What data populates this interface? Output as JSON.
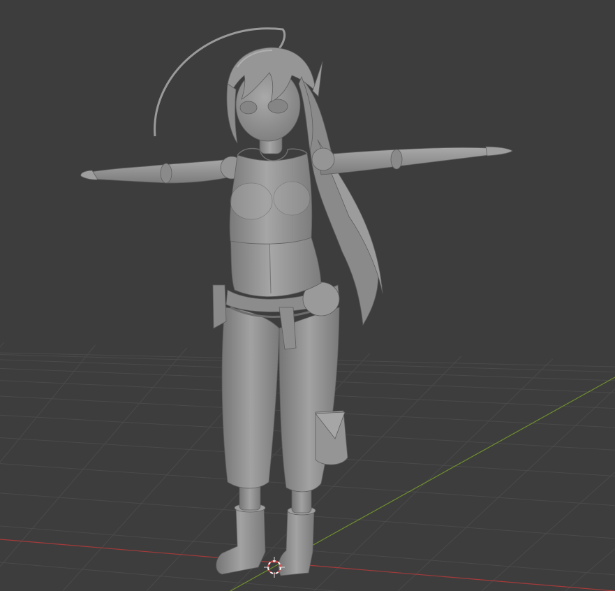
{
  "viewport": {
    "kind": "3d-viewport",
    "model": "character-t-pose-solid-shading",
    "colors": {
      "background": "#3d3d3d",
      "grid_line": "#4a4a4a",
      "x_axis": "#a63a3a",
      "y_axis": "#6f8f2e",
      "mesh_base": "#8d8d8d",
      "mesh_light": "#a9a9a9",
      "mesh_shadow": "#6e6e6e",
      "cursor_red": "#d94a4a",
      "cursor_white": "#ffffff"
    },
    "icons": [
      "3d-cursor-icon"
    ]
  }
}
